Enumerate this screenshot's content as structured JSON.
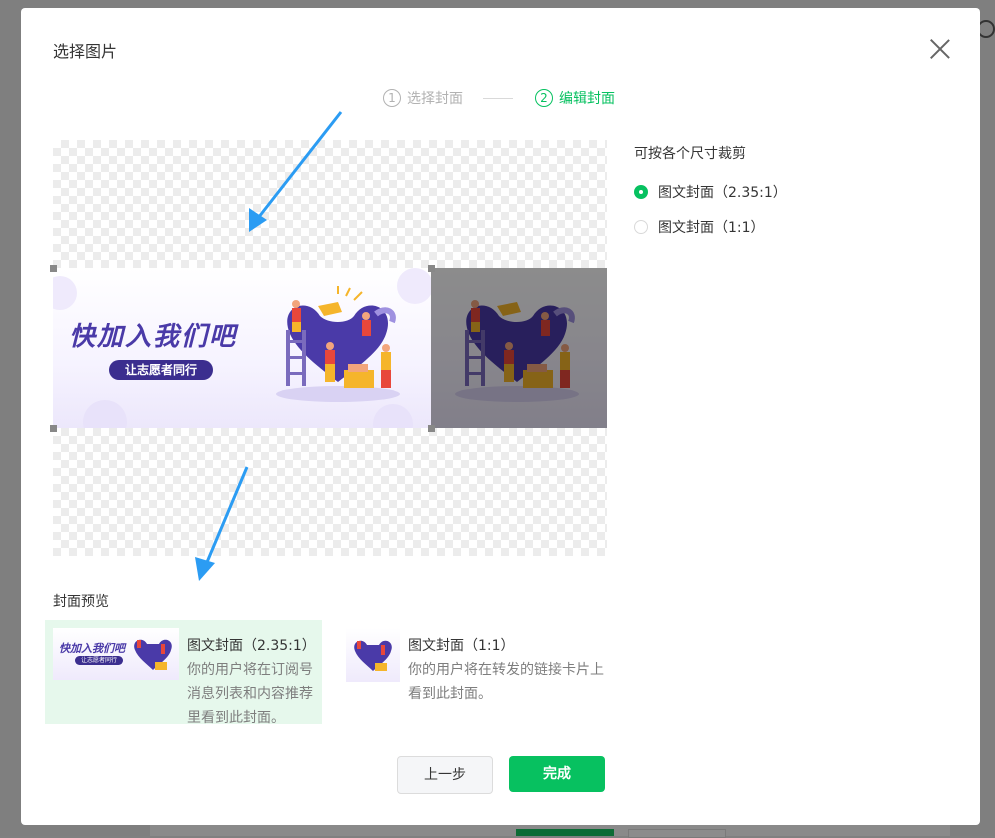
{
  "dialog": {
    "title": "选择图片"
  },
  "steps": [
    {
      "num": "1",
      "label": "选择封面",
      "active": false
    },
    {
      "num": "2",
      "label": "编辑封面",
      "active": true
    }
  ],
  "banner": {
    "headline": "快加入我们吧",
    "subline": "让志愿者同行"
  },
  "crop": {
    "title": "可按各个尺寸裁剪",
    "options": [
      {
        "label": "图文封面（2.35:1）",
        "selected": true
      },
      {
        "label": "图文封面（1:1）",
        "selected": false
      }
    ]
  },
  "preview": {
    "title": "封面预览",
    "cards": [
      {
        "name": "图文封面（2.35:1）",
        "desc": "你的用户将在订阅号消息列表和内容推荐里看到此封面。"
      },
      {
        "name": "图文封面（1:1）",
        "desc": "你的用户将在转发的链接卡片上看到此封面。"
      }
    ]
  },
  "buttons": {
    "prev": "上一步",
    "done": "完成"
  },
  "colors": {
    "accent": "#07c160",
    "overlay": "#808080",
    "arrow": "#2b9cf3",
    "banner_purple": "#4a3aa8"
  }
}
